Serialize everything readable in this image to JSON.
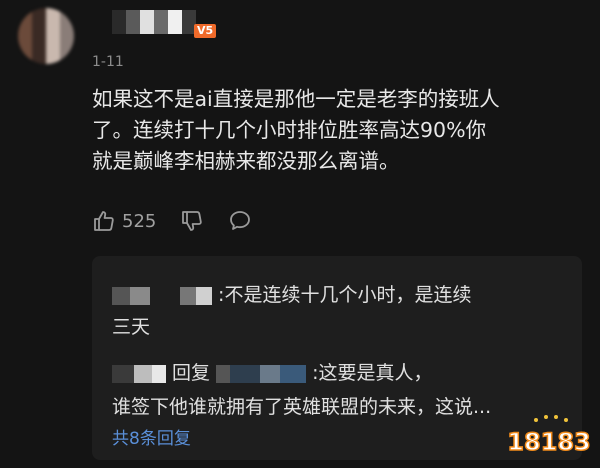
{
  "comment": {
    "date": "1-11",
    "level_badge": "V5",
    "text_lines": [
      "如果这不是ai直接是那他一定是老李的接班人",
      "了。连续打十几个小时排位胜率高达90%你",
      "就是巅峰李相赫来都没那么离谱。"
    ],
    "like_count": "525"
  },
  "icons": {
    "like": "thumbs-up-icon",
    "dislike": "thumbs-down-icon",
    "reply": "comment-bubble-icon"
  },
  "replies": [
    {
      "text_line1": ":不是连续十几个小时，是连续",
      "text_line2": "三天"
    },
    {
      "reply_label": "回复",
      "text_line1": ":这要是真人，",
      "text_line2": "谁签下他谁就拥有了英雄联盟的未来，这说..."
    }
  ],
  "reply_footer": "共8条回复",
  "watermark_text": "18183",
  "colors": {
    "background": "#141414",
    "reply_box": "#1e1e1e",
    "link": "#5a8fd8",
    "badge": "#f06a2a"
  }
}
